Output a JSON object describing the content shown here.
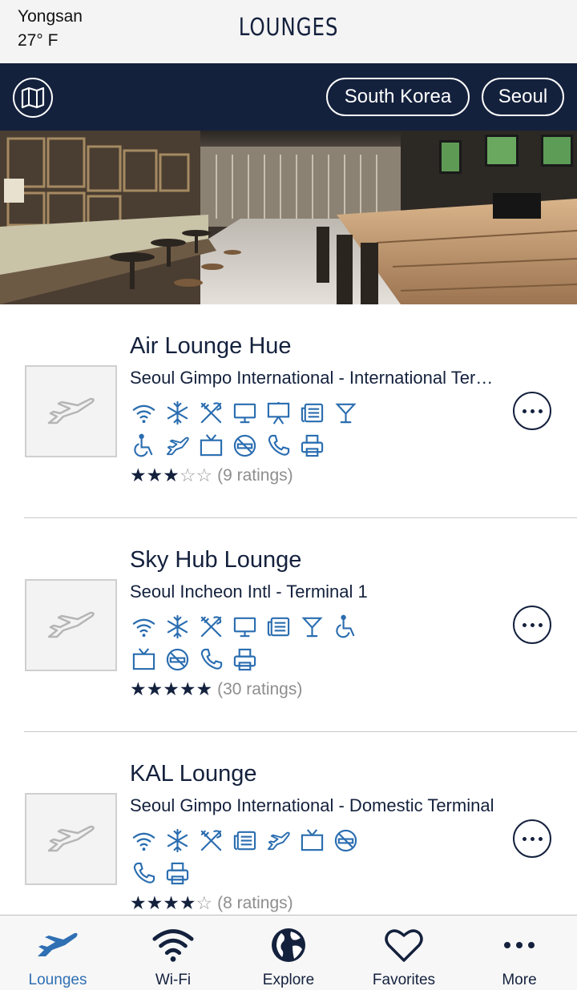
{
  "status": {
    "location_name": "Yongsan",
    "temperature": "27° F"
  },
  "header": {
    "title": "LOUNGES"
  },
  "filters": {
    "country": "South Korea",
    "city": "Seoul"
  },
  "lounges": [
    {
      "name": "Air Lounge Hue",
      "airport": "Seoul Gimpo International - International Terminal",
      "amenities_row1": [
        "wifi-icon",
        "air-conditioning-icon",
        "dining-icon",
        "computer-icon",
        "presentation-icon",
        "newspaper-icon",
        "bar-icon"
      ],
      "amenities_row2": [
        "accessible-icon",
        "flight-info-icon",
        "tv-icon",
        "no-smoking-icon",
        "phone-icon",
        "printer-icon"
      ],
      "stars": 3,
      "ratings_text": "(9 ratings)"
    },
    {
      "name": "Sky Hub Lounge",
      "airport": "Seoul Incheon Intl - Terminal 1",
      "amenities_row1": [
        "wifi-icon",
        "air-conditioning-icon",
        "dining-icon",
        "computer-icon",
        "newspaper-icon",
        "bar-icon",
        "accessible-icon"
      ],
      "amenities_row2": [
        "tv-icon",
        "no-smoking-icon",
        "phone-icon",
        "printer-icon"
      ],
      "stars": 5,
      "ratings_text": "(30 ratings)"
    },
    {
      "name": "KAL Lounge",
      "airport": "Seoul Gimpo International - Domestic Terminal",
      "amenities_row1": [
        "wifi-icon",
        "air-conditioning-icon",
        "dining-icon",
        "newspaper-icon",
        "flight-info-icon",
        "tv-icon",
        "no-smoking-icon"
      ],
      "amenities_row2": [
        "phone-icon",
        "printer-icon"
      ],
      "stars": 4,
      "ratings_text": "(8 ratings)"
    }
  ],
  "tabs": [
    {
      "label": "Lounges",
      "icon": "plane-icon",
      "active": true
    },
    {
      "label": "Wi-Fi",
      "icon": "wifi-icon",
      "active": false
    },
    {
      "label": "Explore",
      "icon": "globe-icon",
      "active": false
    },
    {
      "label": "Favorites",
      "icon": "heart-icon",
      "active": false
    },
    {
      "label": "More",
      "icon": "more-dots-icon",
      "active": false
    }
  ],
  "colors": {
    "navy": "#14213d",
    "accent_blue": "#2f6fb3",
    "amenity_blue": "#2a6db0",
    "header_gray": "#f5f4f4"
  }
}
